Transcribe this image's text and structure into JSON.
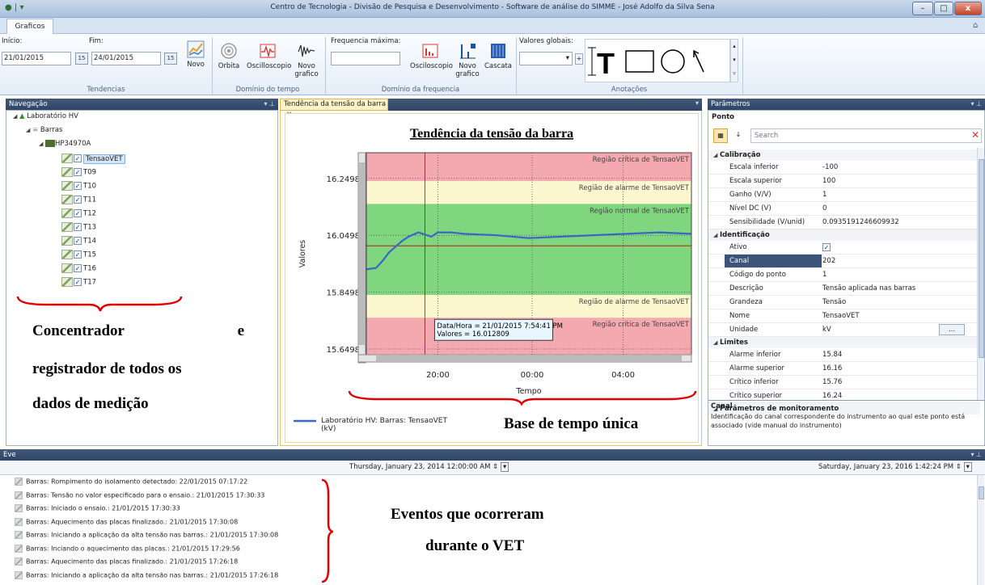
{
  "window": {
    "title": "Centro de Tecnologia - Divisão de Pesquisa e Desenvolvimento - Software de análise do SIMME - José Adolfo da Silva Sena",
    "minimize_glyph": "–",
    "maximize_glyph": "□",
    "close_glyph": "x"
  },
  "ribbon": {
    "tab": "Graficos",
    "tendencias": {
      "inicio_label": "Início:",
      "fim_label": "Fim:",
      "inicio_value": "21/01/2015",
      "fim_value": "24/01/2015",
      "calendar_label": "15",
      "novo_label": "Novo",
      "group_label": "Tendencias"
    },
    "dominio_tempo": {
      "orbita_label": "Orbita",
      "osciloscopio_label": "Oscilloscopio",
      "novo_grafico_label": "Novo grafico",
      "group_label": "Domínio do tempo"
    },
    "dominio_frequencia": {
      "freq_label": "Frequencia máxima:",
      "osciloscopio_label": "Osciloscopio",
      "novo_grafico_label": "Novo grafico",
      "cascata_label": "Cascata",
      "group_label": "Domínio da frequencia"
    },
    "anotacoes": {
      "valores_label": "Valores globais:",
      "group_label": "Anotações"
    }
  },
  "navigation": {
    "title": "Navegação",
    "root": "Laboratório HV",
    "barras": "Barras",
    "device": "HP34970A",
    "points": [
      "TensaoVET",
      "T09",
      "T10",
      "T11",
      "T12",
      "T13",
      "T14",
      "T15",
      "T16",
      "T17"
    ],
    "check_glyph": "✓"
  },
  "annotations": {
    "left_line1": "Concentrador",
    "left_line1_end": "e",
    "left_line2": "registrador de todos os",
    "left_line3": "dados de medição",
    "chart_note": "Base de tempo única",
    "events_line1": "Eventos que ocorreram",
    "events_line2": "durante o VET"
  },
  "document": {
    "tab_label": "Tendência da tensão da barra",
    "close_glyph": "✕"
  },
  "chart_data": {
    "type": "line",
    "title": "Tendência da tensão da barra",
    "xlabel": "Tempo",
    "ylabel": "Valores",
    "x_ticks": [
      "20:00",
      "00:00",
      "04:00"
    ],
    "y_ticks": [
      "16.2498",
      "16.0498",
      "15.8498",
      "15.6498"
    ],
    "ylim": [
      15.63,
      16.34
    ],
    "regions": [
      {
        "label": "Região crítica de TensaoVET",
        "from": 16.24,
        "to": 16.34,
        "color": "#f4a8b0"
      },
      {
        "label": "Região de alarme de TensaoVET",
        "from": 16.16,
        "to": 16.24,
        "color": "#fdf7cf"
      },
      {
        "label": "Região normal de TensaoVET",
        "from": 15.84,
        "to": 16.16,
        "color": "#7fd67f"
      },
      {
        "label": "Região de alarme de TensaoVET",
        "from": 15.76,
        "to": 15.84,
        "color": "#fdf7cf"
      },
      {
        "label": "Região crítica de TensaoVET",
        "from": 15.63,
        "to": 15.76,
        "color": "#f4a8b0"
      }
    ],
    "series": [
      {
        "name": "Laboratório HV: Barras: TensaoVET (kV)",
        "color": "#3a67c6",
        "x": [
          0,
          0.03,
          0.05,
          0.07,
          0.09,
          0.11,
          0.13,
          0.16,
          0.2,
          0.22,
          0.24,
          0.26,
          0.3,
          0.4,
          0.5,
          0.6,
          0.7,
          0.8,
          0.9,
          1.0
        ],
        "values": [
          15.93,
          15.935,
          15.96,
          15.99,
          16.01,
          16.03,
          16.045,
          16.06,
          16.045,
          16.06,
          16.06,
          16.06,
          16.055,
          16.05,
          16.04,
          16.045,
          16.05,
          16.055,
          16.06,
          16.055
        ]
      }
    ],
    "tooltip": {
      "line1": "Data/Hora = 21/01/2015 7:54:41 PM",
      "line2": "Valores = 16.012809"
    },
    "legend": "Laboratório HV: Barras: TensaoVET (kV)"
  },
  "parameters": {
    "title": "Parâmetros",
    "section": "Ponto",
    "search_placeholder": "Search",
    "categories": {
      "calibracao": "Calibração",
      "identificacao": "Identificação",
      "limites": "Limites",
      "monitoramento": "Parâmetros de monitoramento"
    },
    "calibracao": [
      {
        "name": "Escala inferior",
        "value": "-100"
      },
      {
        "name": "Escala superior",
        "value": "100"
      },
      {
        "name": "Ganho (V/V)",
        "value": "1"
      },
      {
        "name": "Nível DC (V)",
        "value": "0"
      },
      {
        "name": "Sensibilidade (V/unid)",
        "value": "0.0935191246609932"
      }
    ],
    "identificacao": [
      {
        "name": "Ativo",
        "value": "✓"
      },
      {
        "name": "Canal",
        "value": "202"
      },
      {
        "name": "Código do ponto",
        "value": "1"
      },
      {
        "name": "Descrição",
        "value": "Tensão aplicada nas barras"
      },
      {
        "name": "Grandeza",
        "value": "Tensão"
      },
      {
        "name": "Nome",
        "value": "TensaoVET"
      },
      {
        "name": "Unidade",
        "value": "kV"
      }
    ],
    "limites": [
      {
        "name": "Alarme inferior",
        "value": "15.84"
      },
      {
        "name": "Alarme superior",
        "value": "16.16"
      },
      {
        "name": "Crítico inferior",
        "value": "15.76"
      },
      {
        "name": "Crítico superior",
        "value": "16.24"
      }
    ],
    "help_title": "Canal",
    "help_text": "Identificação do canal correspondente do instrumento ao qual este ponto está associado (vide manual do instrumento)",
    "ellipsis": "..."
  },
  "events": {
    "title": "Eve",
    "date_from": "Thursday, January 23, 2014 12:00:00 AM",
    "date_to": "Saturday, January 23, 2016 1:42:24 PM",
    "items": [
      "Barras: Rompimento do isolamento detectado: 22/01/2015 07:17:22",
      "Barras: Tensão no valor especificado para o ensaio.: 21/01/2015 17:30:33",
      "Barras: Iniciado o ensaio.: 21/01/2015 17:30:33",
      "Barras: Aquecimento das placas finalizado.: 21/01/2015 17:30:08",
      "Barras: Iniciando a aplicação da alta tensão nas barras.: 21/01/2015 17:30:08",
      "Barras: Inciando o aquecimento das placas.: 21/01/2015 17:29:56",
      "Barras: Aquecimento das placas finalizado.: 21/01/2015 17:26:18",
      "Barras: Iniciando a aplicação da alta tensão nas barras.: 21/01/2015 17:26:18"
    ]
  },
  "colors": {
    "panel_header": "#2f4566",
    "annotation_red": "#e00000",
    "series_blue": "#3a67c6",
    "tooltip_bg": "#e8f7ff"
  }
}
